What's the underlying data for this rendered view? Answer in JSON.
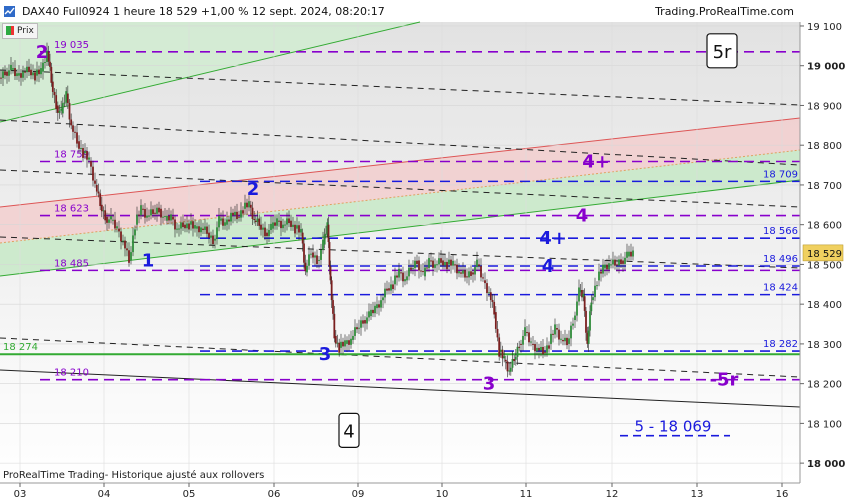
{
  "header": {
    "instrument_line": "DAX40 Full0924 1 heure 18 529 +1,00 % 12 sept. 2024, 08:20:17",
    "site": "Trading.ProRealTime.com"
  },
  "legend": {
    "label": "Prix"
  },
  "footer": {
    "text": "ProRealTime Trading- Historique ajusté aux rollovers"
  },
  "colors": {
    "up_candle": "#2e8b3a",
    "down_candle": "#7a1f1f",
    "purple": "#8800cc",
    "blue": "#1a1add",
    "green_line": "#33aa33",
    "red_line": "#dd5555",
    "current_price_bg": "#f0d060"
  },
  "chart_data": {
    "type": "candlestick",
    "y_axis": {
      "ylim": [
        17950,
        19110
      ],
      "ticks": [
        18000,
        18100,
        18200,
        18300,
        18400,
        18500,
        18600,
        18700,
        18800,
        18900,
        19000,
        19100
      ],
      "tick_labels": [
        "18 000",
        "18 100",
        "18 200",
        "18 300",
        "18 400",
        "18 500",
        "18 600",
        "18 700",
        "18 800",
        "18 900",
        "19 000",
        "19 100"
      ]
    },
    "x_axis": {
      "tick_labels": [
        "03",
        "04",
        "05",
        "06",
        "09",
        "10",
        "11",
        "12",
        "13",
        "16"
      ]
    },
    "current_price": {
      "value": 18529,
      "label": "18 529"
    },
    "price_series": [
      [
        0,
        18970
      ],
      [
        6,
        18985
      ],
      [
        12,
        18990
      ],
      [
        18,
        18975
      ],
      [
        24,
        18985
      ],
      [
        30,
        18990
      ],
      [
        36,
        18975
      ],
      [
        42,
        18985
      ],
      [
        48,
        19035
      ],
      [
        52,
        18960
      ],
      [
        57,
        18900
      ],
      [
        62,
        18880
      ],
      [
        67,
        18930
      ],
      [
        72,
        18850
      ],
      [
        78,
        18810
      ],
      [
        84,
        18780
      ],
      [
        90,
        18760
      ],
      [
        96,
        18700
      ],
      [
        101,
        18650
      ],
      [
        106,
        18620
      ],
      [
        112,
        18610
      ],
      [
        118,
        18590
      ],
      [
        124,
        18560
      ],
      [
        130,
        18510
      ],
      [
        136,
        18600
      ],
      [
        142,
        18640
      ],
      [
        148,
        18620
      ],
      [
        154,
        18630
      ],
      [
        160,
        18640
      ],
      [
        166,
        18610
      ],
      [
        172,
        18620
      ],
      [
        178,
        18590
      ],
      [
        184,
        18600
      ],
      [
        190,
        18600
      ],
      [
        196,
        18590
      ],
      [
        202,
        18590
      ],
      [
        208,
        18580
      ],
      [
        214,
        18560
      ],
      [
        220,
        18610
      ],
      [
        226,
        18600
      ],
      [
        232,
        18630
      ],
      [
        238,
        18620
      ],
      [
        244,
        18640
      ],
      [
        250,
        18650
      ],
      [
        255,
        18610
      ],
      [
        260,
        18600
      ],
      [
        266,
        18580
      ],
      [
        272,
        18590
      ],
      [
        278,
        18610
      ],
      [
        284,
        18600
      ],
      [
        290,
        18610
      ],
      [
        296,
        18590
      ],
      [
        302,
        18580
      ],
      [
        306,
        18480
      ],
      [
        312,
        18530
      ],
      [
        318,
        18510
      ],
      [
        324,
        18550
      ],
      [
        328,
        18600
      ],
      [
        331,
        18460
      ],
      [
        335,
        18320
      ],
      [
        340,
        18290
      ],
      [
        346,
        18300
      ],
      [
        352,
        18310
      ],
      [
        358,
        18340
      ],
      [
        364,
        18360
      ],
      [
        370,
        18370
      ],
      [
        376,
        18390
      ],
      [
        382,
        18410
      ],
      [
        388,
        18440
      ],
      [
        394,
        18450
      ],
      [
        400,
        18480
      ],
      [
        406,
        18460
      ],
      [
        412,
        18490
      ],
      [
        418,
        18510
      ],
      [
        424,
        18470
      ],
      [
        430,
        18510
      ],
      [
        436,
        18500
      ],
      [
        442,
        18510
      ],
      [
        448,
        18500
      ],
      [
        454,
        18500
      ],
      [
        460,
        18480
      ],
      [
        466,
        18470
      ],
      [
        472,
        18480
      ],
      [
        478,
        18500
      ],
      [
        484,
        18460
      ],
      [
        490,
        18430
      ],
      [
        495,
        18380
      ],
      [
        500,
        18280
      ],
      [
        505,
        18260
      ],
      [
        510,
        18230
      ],
      [
        515,
        18260
      ],
      [
        520,
        18300
      ],
      [
        526,
        18330
      ],
      [
        532,
        18300
      ],
      [
        538,
        18290
      ],
      [
        544,
        18280
      ],
      [
        550,
        18300
      ],
      [
        556,
        18340
      ],
      [
        562,
        18310
      ],
      [
        568,
        18300
      ],
      [
        574,
        18360
      ],
      [
        580,
        18430
      ],
      [
        584,
        18420
      ],
      [
        588,
        18300
      ],
      [
        592,
        18410
      ],
      [
        598,
        18460
      ],
      [
        604,
        18490
      ],
      [
        610,
        18500
      ],
      [
        616,
        18500
      ],
      [
        622,
        18510
      ],
      [
        628,
        18520
      ],
      [
        634,
        18529
      ]
    ],
    "horizontal_levels": [
      {
        "value": 19035,
        "label": "19 035",
        "color": "purple"
      },
      {
        "value": 18759,
        "label": "18 759",
        "color": "purple"
      },
      {
        "value": 18709,
        "label": "18 709",
        "color": "blue"
      },
      {
        "value": 18623,
        "label": "18 623",
        "color": "purple"
      },
      {
        "value": 18566,
        "label": "18 566",
        "color": "blue"
      },
      {
        "value": 18496,
        "label": "18 496",
        "color": "blue"
      },
      {
        "value": 18485,
        "label": "18 485",
        "color": "purple"
      },
      {
        "value": 18424,
        "label": "18 424",
        "color": "blue"
      },
      {
        "value": 18282,
        "label": "18 282",
        "color": "blue"
      },
      {
        "value": 18274,
        "label": "18 274",
        "color": "green"
      },
      {
        "value": 18210,
        "label": "18 210",
        "color": "purple"
      },
      {
        "value": 18069,
        "label": "",
        "color": "blue"
      }
    ],
    "wave_labels": [
      {
        "text": "2",
        "color": "purple",
        "y": 19035
      },
      {
        "text": "1",
        "color": "blue",
        "y": 18510
      },
      {
        "text": "2",
        "color": "blue",
        "y": 18690
      },
      {
        "text": "3",
        "color": "blue",
        "y": 18275
      },
      {
        "text": "3",
        "color": "purple",
        "y": 18200
      },
      {
        "text": "4+",
        "color": "purple",
        "y": 18759
      },
      {
        "text": "4",
        "color": "purple",
        "y": 18623
      },
      {
        "text": "4+",
        "color": "blue",
        "y": 18566
      },
      {
        "text": "4",
        "color": "blue",
        "y": 18496
      },
      {
        "text": "-5r",
        "color": "purple",
        "y": 18210
      },
      {
        "text": "5 - 18 069",
        "color": "blue",
        "y": 18095
      }
    ],
    "boxed_labels": [
      {
        "text": "5r",
        "y": 19035
      },
      {
        "text": "4",
        "y": 18090
      }
    ],
    "grid": true,
    "legend_position": "top-left"
  }
}
